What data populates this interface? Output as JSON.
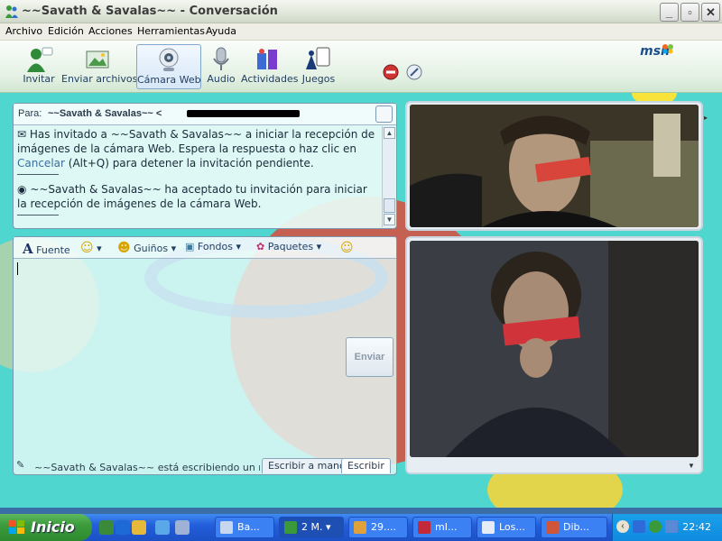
{
  "window": {
    "title": "~~Savath & Savalas~~ - Conversación",
    "minimize": "_",
    "maximize": "▫",
    "close": "✕"
  },
  "menu": [
    "Archivo",
    "Edición",
    "Acciones",
    "Herramientas",
    "Ayuda"
  ],
  "toolbar": {
    "items": [
      {
        "label": "Invitar",
        "icon": "invite-icon"
      },
      {
        "label": "Enviar archivos",
        "icon": "send-files-icon"
      },
      {
        "label": "Cámara Web",
        "icon": "webcam-icon"
      },
      {
        "label": "Audio",
        "icon": "microphone-icon"
      },
      {
        "label": "Actividades",
        "icon": "activities-icon"
      },
      {
        "label": "Juegos",
        "icon": "games-icon"
      }
    ],
    "logo": "msn"
  },
  "conversation": {
    "to_label": "Para:",
    "contact_name": "~~Savath & Savalas~~ <",
    "messages": [
      {
        "before": "Has invitado a ~~Savath & Savalas~~ a iniciar la recepción de imágenes de la cámara Web. Espera la respuesta o haz clic en ",
        "link": "Cancelar",
        "after": " (Alt+Q) para detener la invitación pendiente."
      },
      {
        "text": "~~Savath & Savalas~~ ha aceptado tu invitación para iniciar la recepción de imágenes de la cámara Web."
      }
    ]
  },
  "compose": {
    "format_items": [
      "Fuente",
      "Guiños",
      "Fondos",
      "Paquetes"
    ],
    "send_label": "Enviar"
  },
  "status": {
    "typing_text": "~~Savath & Savalas~~ está escribiendo un mensaje.",
    "tab_handwriting": "Escribir a mano",
    "tab_type": "Escribir"
  },
  "taskbar": {
    "start_label": "Inicio",
    "tasks": [
      "Ba...",
      "2 M.",
      "29....",
      "mI...",
      "Los...",
      "Dib..."
    ],
    "clock": "22:42"
  }
}
